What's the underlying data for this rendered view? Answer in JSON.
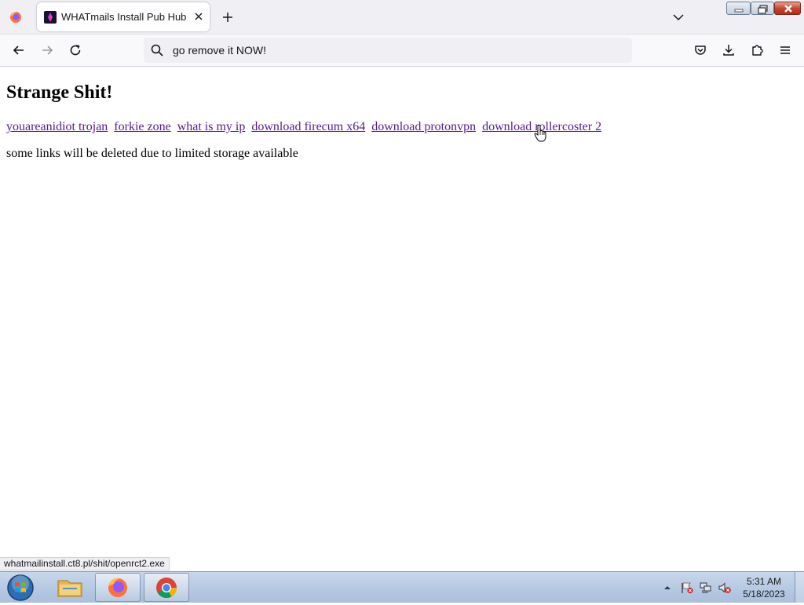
{
  "browser": {
    "tab": {
      "title": "WHATmails Install Pub Hub"
    },
    "address_bar": {
      "value": "go remove it NOW!"
    }
  },
  "page": {
    "heading": "Strange Shit!",
    "links": [
      "youareanidiot trojan",
      "forkie zone",
      "what is my ip",
      "download firecum x64",
      "download protonvpn",
      "download rollercoster 2"
    ],
    "notice": "some links will be deleted due to limited storage available"
  },
  "status_bar": {
    "url": "whatmailinstall.ct8.pl/shit/openrct2.exe"
  },
  "taskbar": {
    "clock": {
      "time": "5:31 AM",
      "date": "5/18/2023"
    }
  },
  "colors": {
    "visited_link": "#551a8b",
    "taskbar": "#b8cbe3"
  }
}
